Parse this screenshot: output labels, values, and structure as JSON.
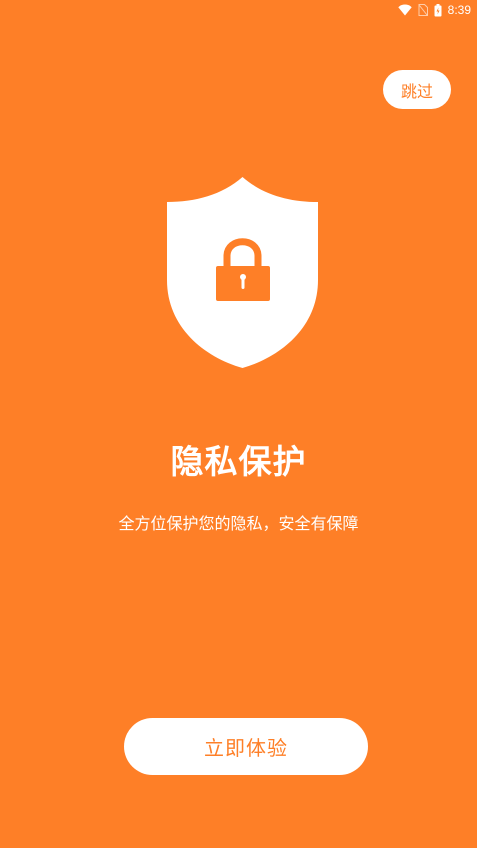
{
  "status_bar": {
    "time": "8:39",
    "icons": [
      "wifi-icon",
      "sim-icon",
      "battery-icon"
    ]
  },
  "skip_label": "跳过",
  "title": "隐私保护",
  "subtitle": "全方位保护您的隐私，安全有保障",
  "start_label": "立即体验",
  "colors": {
    "background": "#FE7F27",
    "foreground": "#FFFFFF",
    "accent": "#FE7F27"
  },
  "illustration": "shield-lock-icon"
}
